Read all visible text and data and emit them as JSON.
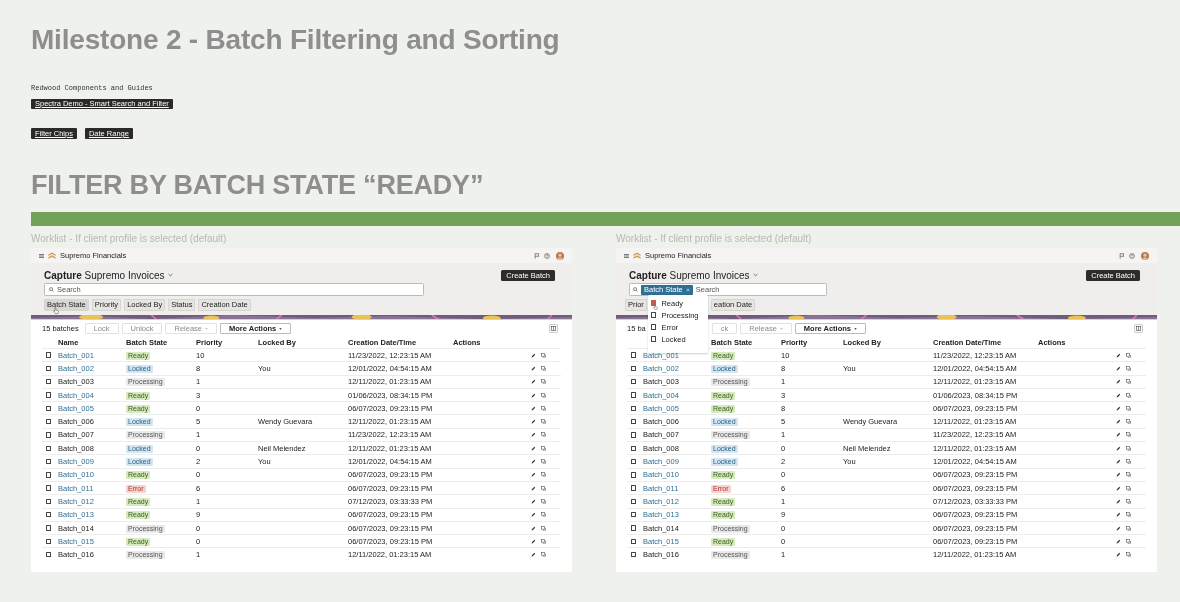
{
  "title": "Milestone 2 - Batch Filtering and Sorting",
  "subtitle": "Redwood Components and Guides",
  "demo_button": "Spectra Demo - Smart Search and Filter",
  "link_buttons": [
    "Filter Chips",
    "Date Range"
  ],
  "section_heading": "FILTER BY BATCH STATE “READY”",
  "panels": [
    {
      "caption": "Worklist - If client profile is selected (default)",
      "app_name": "Supremo Financials",
      "page_title_bold": "Capture",
      "page_title": "Supremo Invoices",
      "create_button": "Create Batch",
      "search": {
        "placeholder": "Search"
      },
      "filter_chips": [
        {
          "label": "Batch State",
          "hovered": true
        },
        {
          "label": "Priority",
          "hovered": false
        },
        {
          "label": "Locked By",
          "hovered": false
        },
        {
          "label": "Status",
          "hovered": false
        },
        {
          "label": "Creation Date",
          "hovered": false
        }
      ],
      "toolbar": {
        "count": "15 batches",
        "buttons": [
          {
            "label": "Lock",
            "disabled": true,
            "menu": false
          },
          {
            "label": "Unlock",
            "disabled": true,
            "menu": false
          },
          {
            "label": "Release",
            "disabled": true,
            "menu": true
          },
          {
            "label": "More Actions",
            "disabled": false,
            "menu": true
          }
        ]
      },
      "columns": [
        {
          "label": "Name",
          "kind": "name"
        },
        {
          "label": "Batch State",
          "kind": "state"
        },
        {
          "label": "Priority",
          "kind": "priority"
        },
        {
          "label": "Locked By",
          "kind": "locked"
        },
        {
          "label": "Creation Date/Time",
          "kind": "created"
        },
        {
          "label": "Actions",
          "kind": "actions"
        }
      ],
      "rows": [
        {
          "name": "Batch_001",
          "link": true,
          "checked": false,
          "kind": "ready",
          "state_label": "Ready",
          "priority": "10",
          "created": "11/23/2022, 12:23:15 AM"
        },
        {
          "name": "Batch_002",
          "link": true,
          "checked": false,
          "kind": "locked",
          "state_label": "Locked",
          "priority": "8",
          "locked_by": "You",
          "created": "12/01/2022, 04:54:15 AM"
        },
        {
          "name": "Batch_003",
          "link": false,
          "checked": false,
          "kind": "processing",
          "state_label": "Processing",
          "priority": "1",
          "created": "12/11/2022, 01:23:15 AM"
        },
        {
          "name": "Batch_004",
          "link": true,
          "checked": false,
          "kind": "ready",
          "state_label": "Ready",
          "priority": "3",
          "created": "01/06/2023, 08:34:15 PM"
        },
        {
          "name": "Batch_005",
          "link": true,
          "checked": false,
          "kind": "ready",
          "state_label": "Ready",
          "priority": "0",
          "created": "06/07/2023, 09:23:15 PM"
        },
        {
          "name": "Batch_006",
          "link": false,
          "checked": false,
          "kind": "locked",
          "state_label": "Locked",
          "priority": "5",
          "locked_by": "Wendy Guevara",
          "created": "12/11/2022, 01:23:15 AM"
        },
        {
          "name": "Batch_007",
          "link": false,
          "checked": false,
          "kind": "processing",
          "state_label": "Processing",
          "priority": "1",
          "created": "11/23/2022, 12:23:15 AM"
        },
        {
          "name": "Batch_008",
          "link": false,
          "checked": false,
          "kind": "locked",
          "state_label": "Locked",
          "priority": "0",
          "locked_by": "Neil Melendez",
          "created": "12/11/2022, 01:23:15 AM"
        },
        {
          "name": "Batch_009",
          "link": true,
          "checked": false,
          "kind": "locked",
          "state_label": "Locked",
          "priority": "2",
          "locked_by": "You",
          "created": "12/01/2022, 04:54:15 AM"
        },
        {
          "name": "Batch_010",
          "link": true,
          "checked": false,
          "kind": "ready",
          "state_label": "Ready",
          "priority": "0",
          "created": "06/07/2023, 09:23:15 PM"
        },
        {
          "name": "Batch_011",
          "link": true,
          "checked": false,
          "kind": "error",
          "state_label": "Error",
          "priority": "6",
          "created": "06/07/2023, 09:23:15 PM"
        },
        {
          "name": "Batch_012",
          "link": true,
          "checked": false,
          "kind": "ready",
          "state_label": "Ready",
          "priority": "1",
          "created": "07/12/2023, 03:33:33 PM"
        },
        {
          "name": "Batch_013",
          "link": true,
          "checked": false,
          "kind": "ready",
          "state_label": "Ready",
          "priority": "9",
          "created": "06/07/2023, 09:23:15 PM"
        },
        {
          "name": "Batch_014",
          "link": false,
          "checked": false,
          "kind": "processing",
          "state_label": "Processing",
          "priority": "0",
          "created": "06/07/2023, 09:23:15 PM"
        },
        {
          "name": "Batch_015",
          "link": true,
          "checked": false,
          "kind": "ready",
          "state_label": "Ready",
          "priority": "0",
          "created": "06/07/2023, 09:23:15 PM"
        },
        {
          "name": "Batch_016",
          "link": false,
          "checked": false,
          "kind": "processing",
          "state_label": "Processing",
          "priority": "1",
          "created": "12/11/2022, 01:23:15 AM"
        }
      ]
    },
    {
      "caption": "Worklist - If client profile is selected (default)",
      "app_name": "Supremo Financials",
      "page_title_bold": "Capture",
      "page_title": "Supremo Invoices",
      "create_button": "Create Batch",
      "search": {
        "placeholder": "Search",
        "chip": "Batch State"
      },
      "filter_chips": [
        {
          "label": "Prior",
          "hovered": false
        },
        {
          "label": "eation Date",
          "hovered": false
        }
      ],
      "dropdown": [
        {
          "label": "Ready",
          "checked": true
        },
        {
          "label": "Processing",
          "checked": false
        },
        {
          "label": "Error",
          "checked": false
        },
        {
          "label": "Locked",
          "checked": false
        }
      ],
      "toolbar": {
        "count": "15 ba",
        "buttons": [
          {
            "label": "ck",
            "disabled": true,
            "menu": false
          },
          {
            "label": "Release",
            "disabled": true,
            "menu": true
          },
          {
            "label": "More Actions",
            "disabled": false,
            "menu": true
          }
        ]
      },
      "columns": [
        {
          "label": "Batch State",
          "kind": "state"
        },
        {
          "label": "Priority",
          "kind": "priority"
        },
        {
          "label": "Locked By",
          "kind": "locked"
        },
        {
          "label": "Creation Date/Time",
          "kind": "created"
        },
        {
          "label": "Actions",
          "kind": "actions"
        }
      ],
      "rows": [
        {
          "name": "Batch_001",
          "link": true,
          "checked": false,
          "kind": "ready",
          "state_label": "Ready",
          "priority": "10",
          "created": "11/23/2022, 12:23:15 AM"
        },
        {
          "name": "Batch_002",
          "link": true,
          "checked": false,
          "kind": "locked",
          "state_label": "Locked",
          "priority": "8",
          "locked_by": "You",
          "created": "12/01/2022, 04:54:15 AM"
        },
        {
          "name": "Batch_003",
          "link": false,
          "checked": false,
          "kind": "processing",
          "state_label": "Processing",
          "priority": "1",
          "created": "12/11/2022, 01:23:15 AM"
        },
        {
          "name": "Batch_004",
          "link": true,
          "checked": false,
          "kind": "ready",
          "state_label": "Ready",
          "priority": "3",
          "created": "01/06/2023, 08:34:15 PM"
        },
        {
          "name": "Batch_005",
          "link": true,
          "checked": false,
          "kind": "ready",
          "state_label": "Ready",
          "priority": "8",
          "created": "06/07/2023, 09:23:15 PM"
        },
        {
          "name": "Batch_006",
          "link": false,
          "checked": false,
          "kind": "locked",
          "state_label": "Locked",
          "priority": "5",
          "locked_by": "Wendy Guevara",
          "created": "12/11/2022, 01:23:15 AM"
        },
        {
          "name": "Batch_007",
          "link": false,
          "checked": false,
          "kind": "processing",
          "state_label": "Processing",
          "priority": "1",
          "created": "11/23/2022, 12:23:15 AM"
        },
        {
          "name": "Batch_008",
          "link": false,
          "checked": false,
          "kind": "locked",
          "state_label": "Locked",
          "priority": "0",
          "locked_by": "Neil Melendez",
          "created": "12/11/2022, 01:23:15 AM"
        },
        {
          "name": "Batch_009",
          "link": true,
          "checked": false,
          "kind": "locked",
          "state_label": "Locked",
          "priority": "2",
          "locked_by": "You",
          "created": "12/01/2022, 04:54:15 AM"
        },
        {
          "name": "Batch_010",
          "link": true,
          "checked": false,
          "kind": "ready",
          "state_label": "Ready",
          "priority": "0",
          "created": "06/07/2023, 09:23:15 PM"
        },
        {
          "name": "Batch_011",
          "link": true,
          "checked": false,
          "kind": "error",
          "state_label": "Error",
          "priority": "6",
          "created": "06/07/2023, 09:23:15 PM"
        },
        {
          "name": "Batch_012",
          "link": true,
          "checked": false,
          "kind": "ready",
          "state_label": "Ready",
          "priority": "1",
          "created": "07/12/2023, 03:33:33 PM"
        },
        {
          "name": "Batch_013",
          "link": true,
          "checked": false,
          "kind": "ready",
          "state_label": "Ready",
          "priority": "9",
          "created": "06/07/2023, 09:23:15 PM"
        },
        {
          "name": "Batch_014",
          "link": false,
          "checked": false,
          "kind": "processing",
          "state_label": "Processing",
          "priority": "0",
          "created": "06/07/2023, 09:23:15 PM"
        },
        {
          "name": "Batch_015",
          "link": true,
          "checked": false,
          "kind": "ready",
          "state_label": "Ready",
          "priority": "0",
          "created": "06/07/2023, 09:23:15 PM"
        },
        {
          "name": "Batch_016",
          "link": false,
          "checked": false,
          "kind": "processing",
          "state_label": "Processing",
          "priority": "1",
          "created": "12/11/2022, 01:23:15 AM"
        }
      ]
    }
  ]
}
